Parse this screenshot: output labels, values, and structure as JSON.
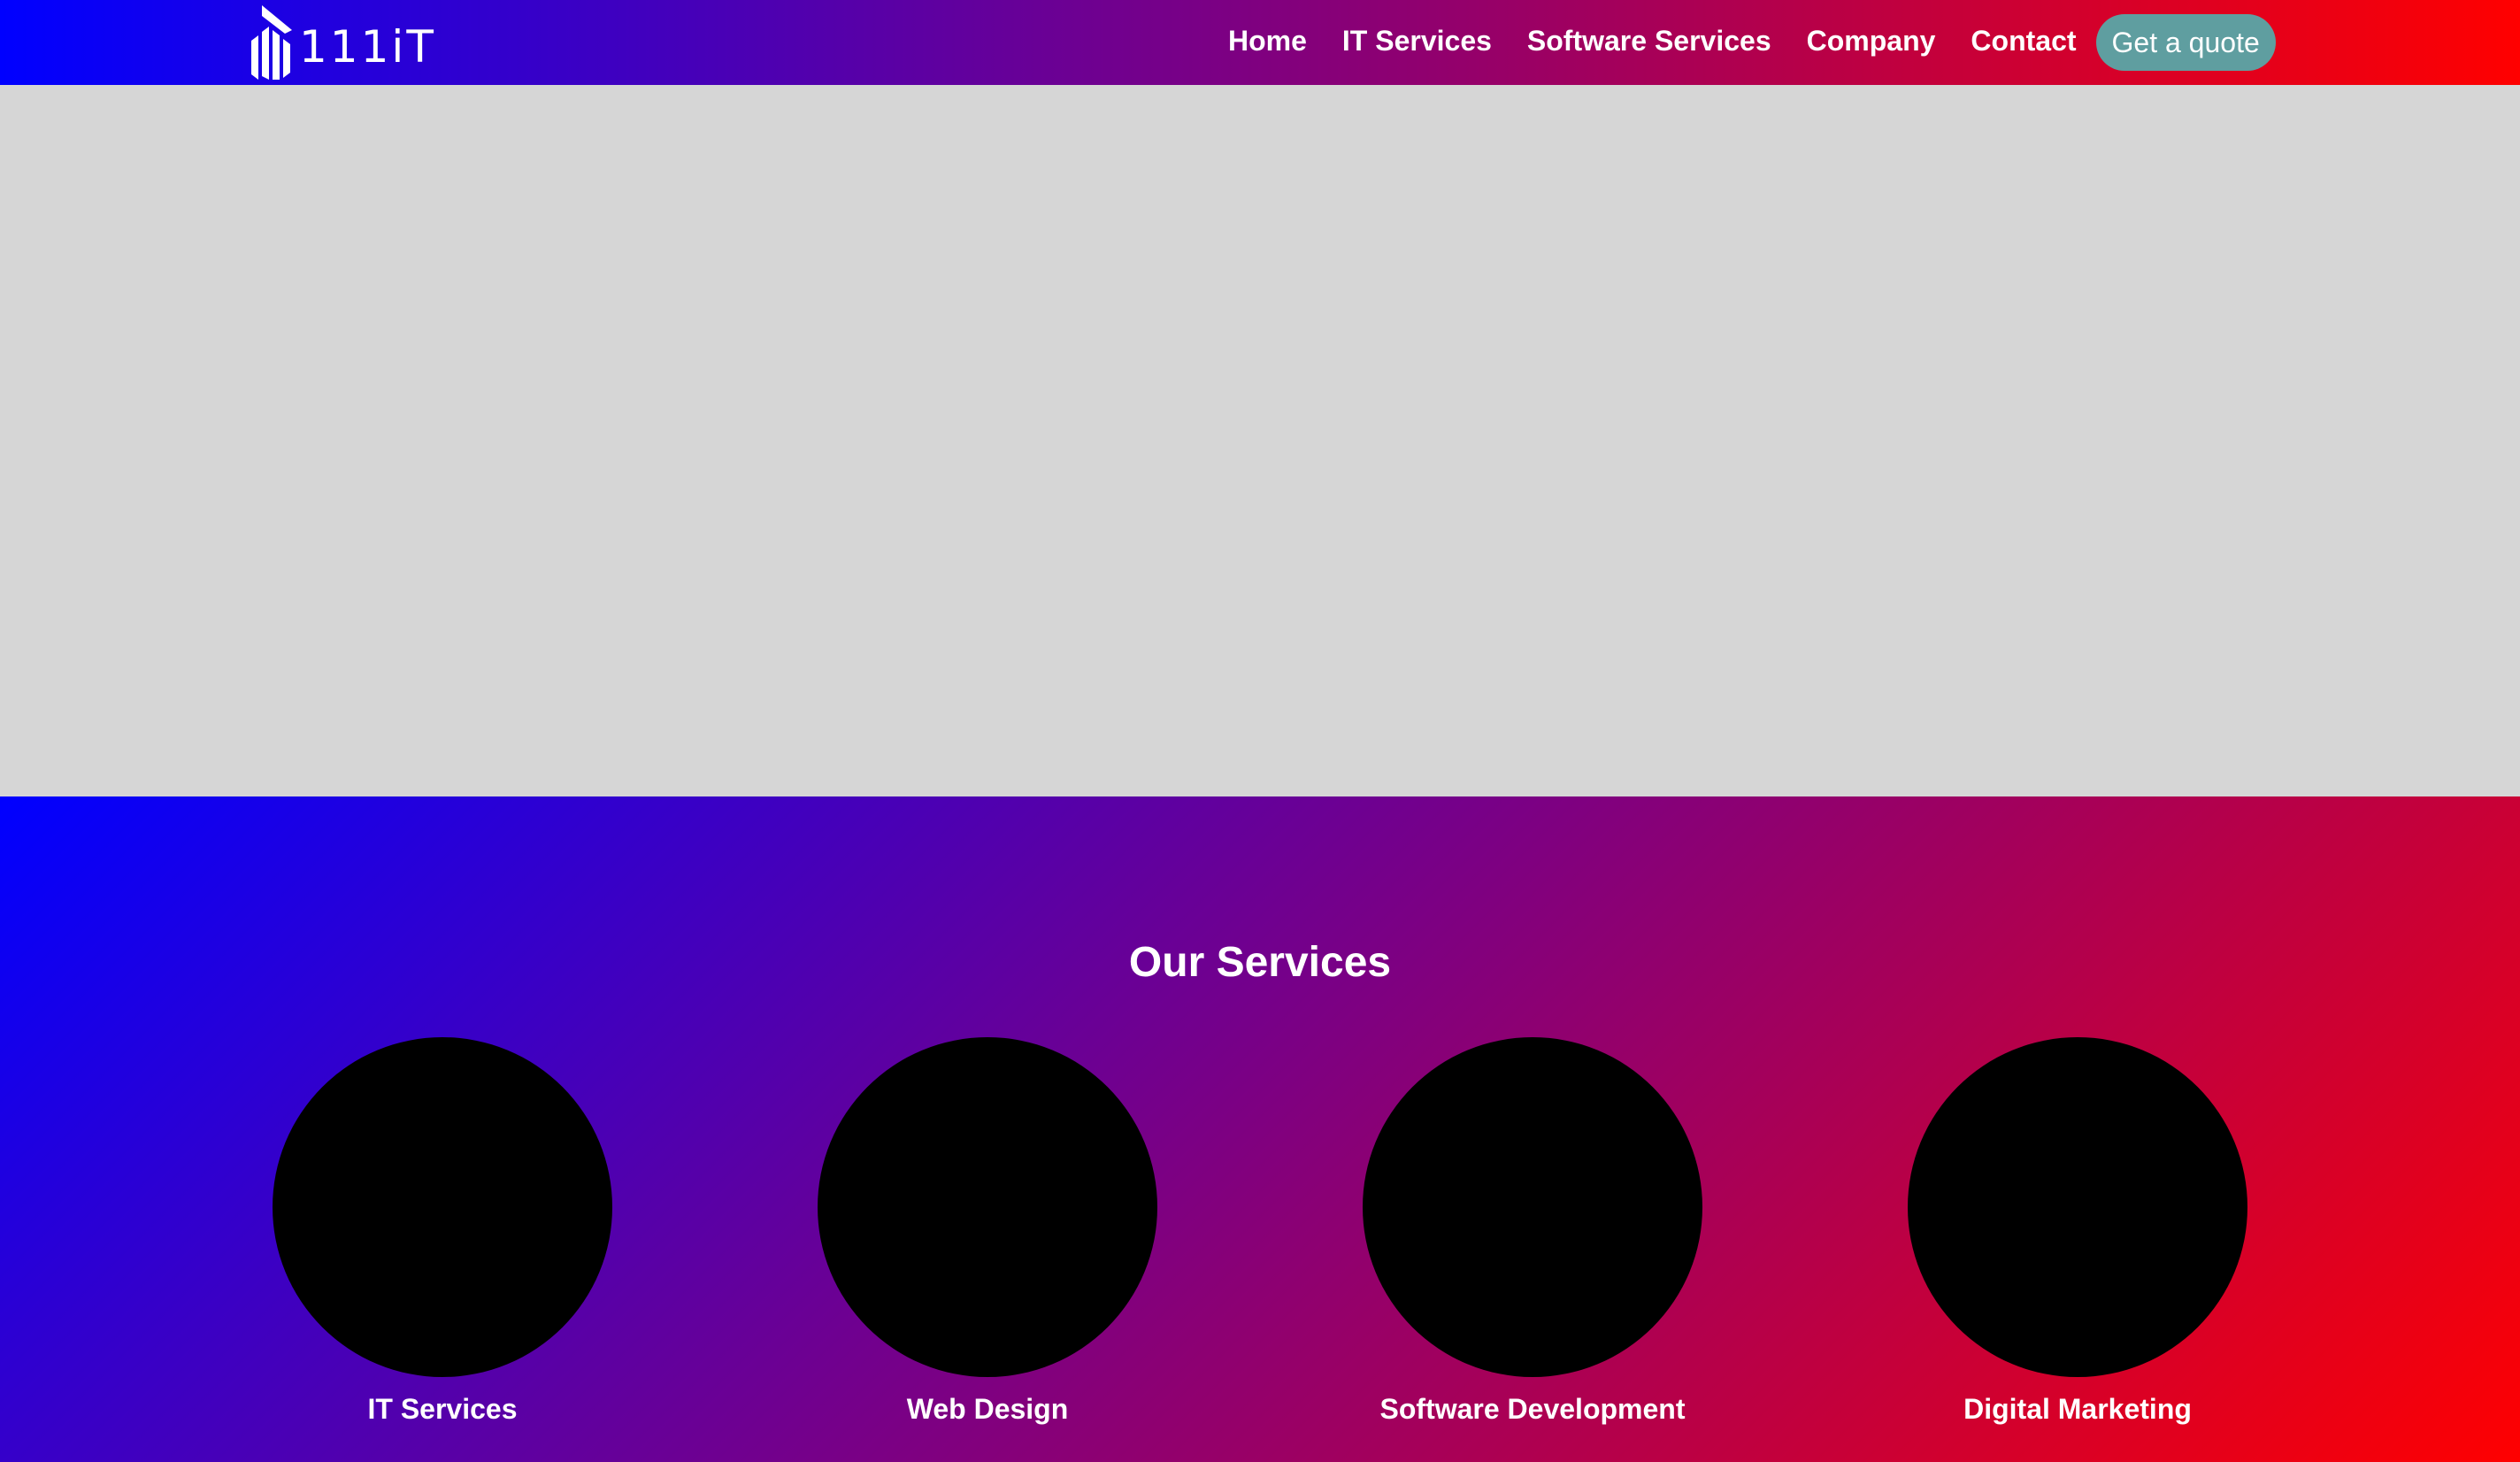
{
  "header": {
    "logo_text": "111iT",
    "nav": [
      {
        "label": "Home",
        "active": true
      },
      {
        "label": "IT Services"
      },
      {
        "label": "Software Services"
      },
      {
        "label": "Company"
      },
      {
        "label": "Contact"
      }
    ],
    "cta_label": "Get a quote"
  },
  "services": {
    "title": "Our Services",
    "items": [
      {
        "label": "IT Services"
      },
      {
        "label": "Web Design"
      },
      {
        "label": "Software Development"
      },
      {
        "label": "Digital Marketing"
      }
    ]
  },
  "colors": {
    "gradient_start": "#0000ff",
    "gradient_end": "#ff0000",
    "cta_background": "#5f9ea0",
    "hero_placeholder": "#d6d6d6"
  }
}
